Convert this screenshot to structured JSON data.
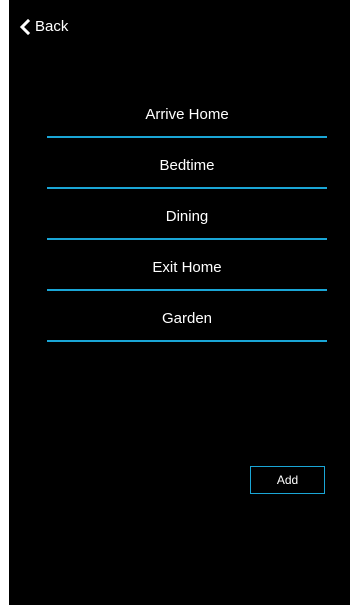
{
  "header": {
    "back_label": "Back",
    "back_icon": "chevron-left-icon"
  },
  "scenes": {
    "items": [
      {
        "label": "Arrive Home"
      },
      {
        "label": "Bedtime"
      },
      {
        "label": "Dining"
      },
      {
        "label": "Exit Home"
      },
      {
        "label": "Garden"
      }
    ]
  },
  "actions": {
    "add_label": "Add"
  },
  "colors": {
    "background": "#000000",
    "accent": "#1aa6d6",
    "text": "#ffffff"
  }
}
